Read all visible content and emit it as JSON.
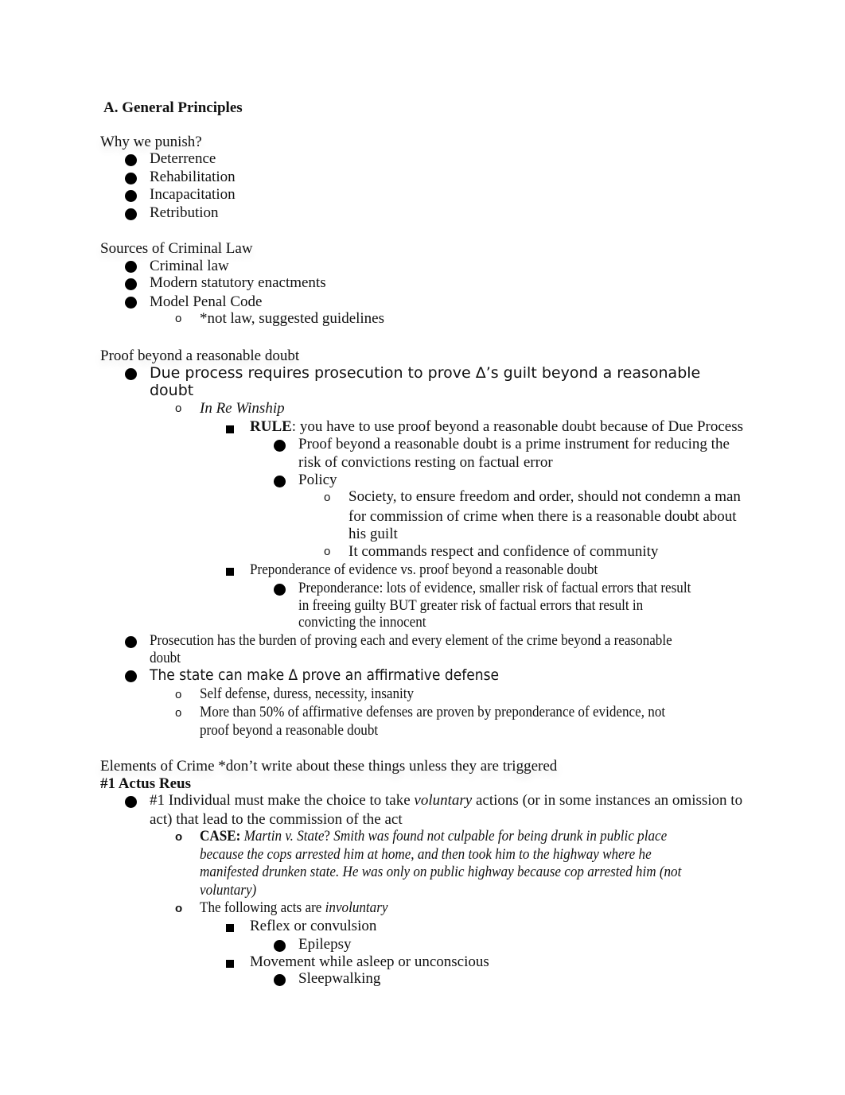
{
  "section_title": "A. General Principles",
  "why_punish": {
    "heading": "Why we punish?",
    "items": [
      "Deterrence",
      "Rehabilitation",
      "Incapacitation",
      "Retribution"
    ]
  },
  "sources": {
    "heading": "Sources of Criminal Law",
    "items": [
      "Criminal law",
      "Modern statutory enactments",
      "Model Penal Code"
    ],
    "mpc_note": "*not law, suggested guidelines"
  },
  "proof": {
    "heading": "Proof beyond a reasonable doubt",
    "due_process_line1": "Due process requires prosecution to prove Δ’s guilt beyond a reasonable",
    "due_process_line2": "doubt",
    "case_name": "In Re Winship",
    "rule_label": "RULE",
    "rule_text": ": you have to use proof beyond a reasonable doubt because of Due Process",
    "rule_point1_line1": "Proof beyond a reasonable doubt is a prime instrument for reducing the",
    "rule_point1_line2": "risk of convictions resting on factual error",
    "policy_label": "Policy",
    "policy_point1_line1": "Society, to ensure freedom and order, should not condemn a man",
    "policy_point1_line2": "for commission of crime when there is a reasonable doubt about",
    "policy_point1_line3": "his guilt",
    "policy_point2": "It commands respect and confidence of community",
    "preponderance_heading": "Preponderance of evidence vs. proof beyond a reasonable doubt",
    "preponderance_line1": "Preponderance: lots of evidence, smaller risk of factual errors that result",
    "preponderance_line2": "in freeing guilty BUT greater risk of factual errors that result in",
    "preponderance_line3": "convicting the innocent",
    "burden_line1": "Prosecution has the burden of proving each and every element of the crime beyond a reasonable",
    "burden_line2": "doubt",
    "affirmative": "The state can make Δ prove an affirmative defense",
    "affirmative_examples": "Self defense, duress, necessity, insanity",
    "affirmative_stat_line1": "More than 50% of affirmative defenses are proven by preponderance of evidence, not",
    "affirmative_stat_line2": "proof beyond a reasonable doubt"
  },
  "elements": {
    "heading": "Elements of Crime",
    "heading_note": " *don’t write about these things unless they are triggered",
    "actus_reus_title": "#1 Actus Reus",
    "point1_pre": "#1 Individual must make the choice to take ",
    "point1_em": "voluntary",
    "point1_post": " actions (or in some instances an omission to",
    "point1_line2": "act) that lead to the commission of the act",
    "case_label": "CASE:",
    "case_name": " Martin v. State",
    "case_q": "?  ",
    "case_line1": "Smith was found not culpable for being drunk in public place",
    "case_line2": "because the cops arrested him at home, and then took him to the highway where he",
    "case_line3": "manifested drunken state. He was only on public highway because cop arrested him (not",
    "case_line4": "voluntary)",
    "involuntary_pre": "The following acts are ",
    "involuntary_em": "involuntary",
    "reflex": "Reflex or convulsion",
    "epilepsy": "Epilepsy",
    "movement": "Movement while asleep or unconscious",
    "sleepwalking": "Sleepwalking"
  }
}
